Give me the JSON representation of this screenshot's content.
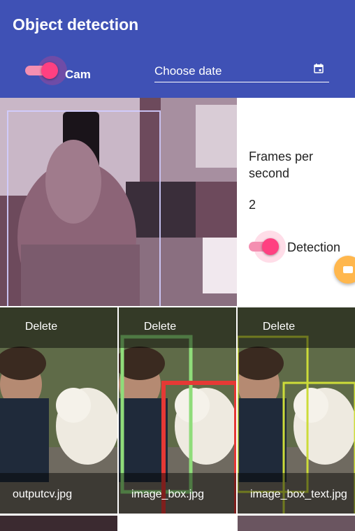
{
  "appbar": {
    "title": "Object detection"
  },
  "controls": {
    "cam_label": "Cam",
    "cam_on": true,
    "date_label": "Choose date",
    "date_icon": "calendar-icon"
  },
  "side": {
    "fps_label": "Frames per second",
    "fps_value": "2",
    "detection_label": "Detection",
    "detection_on": true,
    "fab_icon": "camera-icon"
  },
  "gallery": {
    "items": [
      {
        "delete_label": "Delete",
        "file_name": "outputcv.jpg"
      },
      {
        "delete_label": "Delete",
        "file_name": "image_box.jpg"
      },
      {
        "delete_label": "Delete",
        "file_name": "image_box_text.jpg"
      }
    ]
  },
  "colors": {
    "appbar": "#3f51b5",
    "accent": "#ff4081",
    "fab": "#ffb74d"
  }
}
